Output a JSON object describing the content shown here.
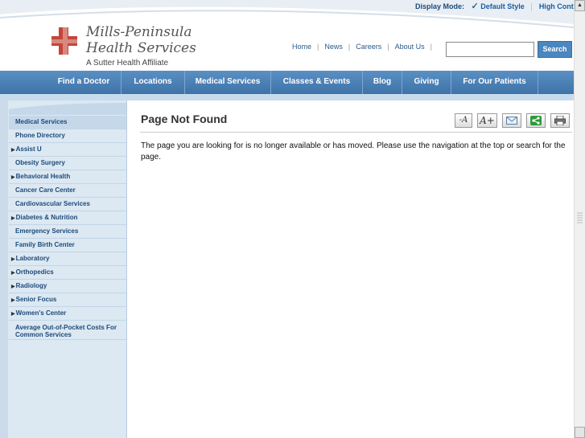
{
  "header": {
    "display_mode_label": "Display Mode:",
    "default_style": "Default Style",
    "high_contrast": "High Cont",
    "logo": {
      "line1": "Mills-Peninsula",
      "line2": "Health Services",
      "line3": "A Sutter Health Affiliate"
    },
    "toplinks": [
      "Home",
      "News",
      "Careers",
      "About Us"
    ],
    "search": {
      "value": "",
      "placeholder": "",
      "button_label": "Search"
    }
  },
  "nav": {
    "items": [
      "Find a Doctor",
      "Locations",
      "Medical Services",
      "Classes & Events",
      "Blog",
      "Giving",
      "For Our Patients"
    ]
  },
  "sidebar": {
    "items": [
      {
        "label": "Medical Services",
        "active": true,
        "expandable": false
      },
      {
        "label": "Phone Directory",
        "active": false,
        "expandable": false
      },
      {
        "label": "Assist U",
        "active": false,
        "expandable": true
      },
      {
        "label": "Obesity Surgery",
        "active": false,
        "expandable": false
      },
      {
        "label": "Behavioral Health",
        "active": false,
        "expandable": true
      },
      {
        "label": "Cancer Care Center",
        "active": false,
        "expandable": false
      },
      {
        "label": "Cardiovascular Services",
        "active": false,
        "expandable": false
      },
      {
        "label": "Diabetes & Nutrition",
        "active": false,
        "expandable": true
      },
      {
        "label": "Emergency Services",
        "active": false,
        "expandable": false
      },
      {
        "label": "Family Birth Center",
        "active": false,
        "expandable": false
      },
      {
        "label": "Laboratory",
        "active": false,
        "expandable": true
      },
      {
        "label": "Orthopedics",
        "active": false,
        "expandable": true
      },
      {
        "label": "Radiology",
        "active": false,
        "expandable": true
      },
      {
        "label": "Senior Focus",
        "active": false,
        "expandable": true
      },
      {
        "label": "Women's Center",
        "active": false,
        "expandable": true
      },
      {
        "label": "Average Out-of-Pocket Costs For Common Services",
        "active": false,
        "expandable": false
      }
    ]
  },
  "main": {
    "title": "Page Not Found",
    "tools": {
      "decrease_font": "-A",
      "increase_font": "A+"
    },
    "message": "The page you are looking for is no longer available or has moved. Please use the navigation at the top or search for the page."
  },
  "colors": {
    "nav_bg": "#4a80b6",
    "sidebar_bg": "#dce8f2",
    "link": "#1d4a7a",
    "search_button": "#4a86c0",
    "logo_red": "#c4463a"
  },
  "icons": {
    "default_style": "checkmark-icon",
    "email": "email-icon",
    "share": "share-icon",
    "print": "print-icon"
  }
}
